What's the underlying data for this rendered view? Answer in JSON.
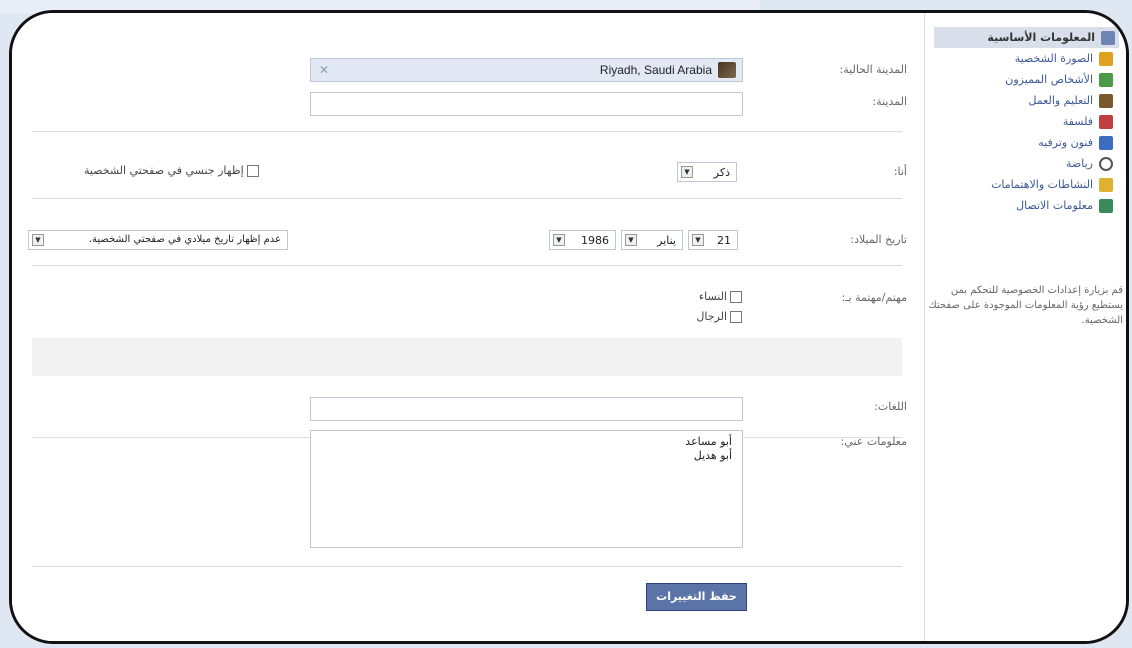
{
  "form": {
    "current_city_label": "المدينة الحالية:",
    "current_city_value": "Riyadh, Saudi Arabia",
    "hometown_label": "المدينة:",
    "hometown_value": "",
    "i_am_label": "أنا:",
    "gender_value": "ذكر",
    "show_gender_label": "إظهار جنسي في صفحتي الشخصية",
    "birthday_label": "تاريخ الميلاد:",
    "birth_day": "21",
    "birth_month": "يناير",
    "birth_year": "1986",
    "birthday_visibility": "عدم إظهار تاريخ ميلادي في صفحتي الشخصية.",
    "interested_in_label": "مهتم/مهتمة بـ:",
    "interested_women": "النساء",
    "interested_men": "الرجال",
    "languages_label": "اللغات:",
    "languages_value": "",
    "about_me_label": "معلومات عني:",
    "about_me_value": "أبو مساعد\nأبو هديل",
    "save_button": "حفظ التغييرات"
  },
  "sidebar": {
    "items": [
      {
        "label": "المعلومات الأساسية",
        "icon": "basic-info-icon",
        "color": "#6d84b4"
      },
      {
        "label": "الصورة الشخصية",
        "icon": "profile-picture-icon",
        "color": "#e0a020"
      },
      {
        "label": "الأشخاص المميزون",
        "icon": "featured-people-icon",
        "color": "#4a9a4a"
      },
      {
        "label": "التعليم والعمل",
        "icon": "education-work-icon",
        "color": "#7a5a2a"
      },
      {
        "label": "فلسفة",
        "icon": "philosophy-icon",
        "color": "#c04040"
      },
      {
        "label": "فنون وترفيه",
        "icon": "arts-entertainment-icon",
        "color": "#3b6cc0"
      },
      {
        "label": "رياضة",
        "icon": "sports-icon",
        "color": "#555555"
      },
      {
        "label": "النشاطات والاهتمامات",
        "icon": "activities-interests-icon",
        "color": "#e0b030"
      },
      {
        "label": "معلومات الاتصال",
        "icon": "contact-info-icon",
        "color": "#3a8a5a"
      }
    ],
    "privacy_text": "قم بزيارة إعدادات الخصوصية للتحكم بمن يستطيع رؤية المعلومات الموجودة على صفحتك الشخصية."
  }
}
